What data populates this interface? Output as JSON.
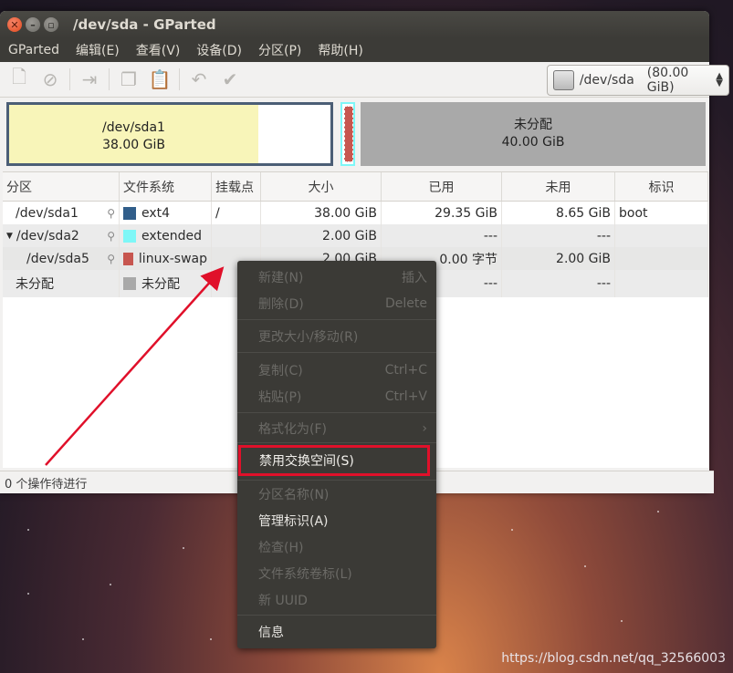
{
  "window": {
    "title": "/dev/sda - GParted"
  },
  "menubar": [
    "GParted",
    "编辑(E)",
    "查看(V)",
    "设备(D)",
    "分区(P)",
    "帮助(H)"
  ],
  "device": {
    "name": "/dev/sda",
    "size": "(80.00 GiB)"
  },
  "graph": {
    "sda1": {
      "name": "/dev/sda1",
      "size": "38.00 GiB"
    },
    "unallocated": {
      "name": "未分配",
      "size": "40.00 GiB"
    }
  },
  "table": {
    "headers": [
      "分区",
      "文件系统",
      "挂载点",
      "大小",
      "已用",
      "未用",
      "标识"
    ],
    "rows": [
      {
        "partition": "/dev/sda1",
        "fs": "ext4",
        "color": "#315e8a",
        "mount": "/",
        "size": "38.00 GiB",
        "used": "29.35 GiB",
        "unused": "8.65 GiB",
        "flags": "boot"
      },
      {
        "partition": "/dev/sda2",
        "fs": "extended",
        "color": "#7ef7f7",
        "mount": "",
        "size": "2.00 GiB",
        "used": "---",
        "unused": "---",
        "flags": ""
      },
      {
        "partition": "/dev/sda5",
        "fs": "linux-swap",
        "color": "#c7564f",
        "mount": "",
        "size": "2.00 GiB",
        "used": "0.00 字节",
        "unused": "2.00 GiB",
        "flags": ""
      },
      {
        "partition": "未分配",
        "fs": "未分配",
        "color": "#a9a9a9",
        "mount": "",
        "size": "",
        "used": "---",
        "unused": "---",
        "flags": ""
      }
    ]
  },
  "status": "0 个操作待进行",
  "context_menu": {
    "new": "新建(N)",
    "new_acc": "插入",
    "delete": "删除(D)",
    "delete_acc": "Delete",
    "resize": "更改大小/移动(R)",
    "copy": "复制(C)",
    "copy_acc": "Ctrl+C",
    "paste": "粘贴(P)",
    "paste_acc": "Ctrl+V",
    "format": "格式化为(F)",
    "swapoff": "禁用交换空间(S)",
    "name": "分区名称(N)",
    "manage_flags": "管理标识(A)",
    "check": "检查(H)",
    "label": "文件系统卷标(L)",
    "uuid": "新 UUID",
    "info": "信息"
  },
  "watermark": "https://blog.csdn.net/qq_32566003",
  "colors": {
    "highlight": "#e0102a",
    "arrow": "#e0102a"
  }
}
